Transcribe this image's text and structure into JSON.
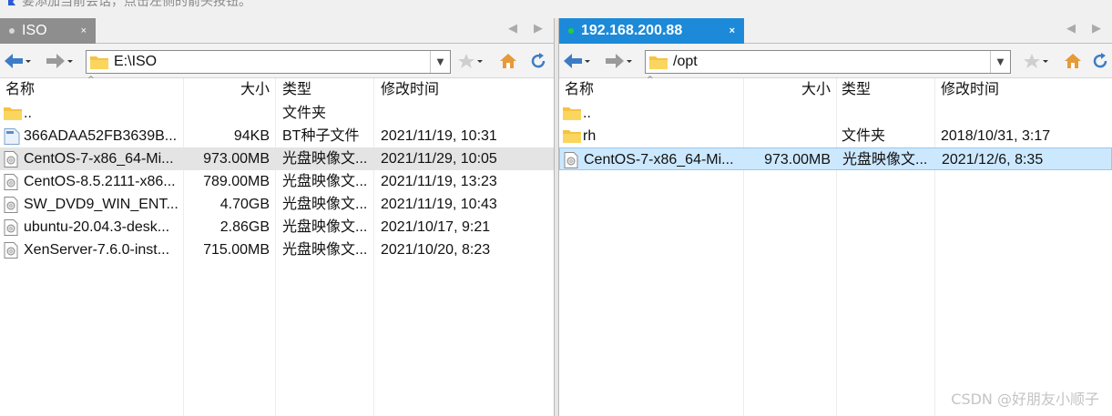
{
  "top_hint": "要添加当前会话，点击左侧的箭头按钮。",
  "left": {
    "tab_title": "ISO",
    "tab_close": "×",
    "path": "E:\\ISO",
    "columns": [
      "名称",
      "大小",
      "类型",
      "修改时间"
    ],
    "rows": [
      {
        "name": "..",
        "size": "",
        "type": "文件夹",
        "modified": "",
        "icon": "folder-icon"
      },
      {
        "name": "366ADAA52FB3639B...",
        "size": "94KB",
        "type": "BT种子文件",
        "modified": "2021/11/19, 10:31",
        "icon": "torrent-file-icon"
      },
      {
        "name": "CentOS-7-x86_64-Mi...",
        "size": "973.00MB",
        "type": "光盘映像文...",
        "modified": "2021/11/29, 10:05",
        "icon": "disc-image-icon",
        "selected": true
      },
      {
        "name": "CentOS-8.5.2111-x86...",
        "size": "789.00MB",
        "type": "光盘映像文...",
        "modified": "2021/11/19, 13:23",
        "icon": "disc-image-icon"
      },
      {
        "name": "SW_DVD9_WIN_ENT...",
        "size": "4.70GB",
        "type": "光盘映像文...",
        "modified": "2021/11/19, 10:43",
        "icon": "disc-image-icon"
      },
      {
        "name": "ubuntu-20.04.3-desk...",
        "size": "2.86GB",
        "type": "光盘映像文...",
        "modified": "2021/10/17, 9:21",
        "icon": "disc-image-icon"
      },
      {
        "name": "XenServer-7.6.0-inst...",
        "size": "715.00MB",
        "type": "光盘映像文...",
        "modified": "2021/10/20, 8:23",
        "icon": "disc-image-icon"
      }
    ]
  },
  "right": {
    "tab_title": "192.168.200.88",
    "tab_close": "×",
    "path": "/opt",
    "columns": [
      "名称",
      "大小",
      "类型",
      "修改时间"
    ],
    "rows": [
      {
        "name": "..",
        "size": "",
        "type": "",
        "modified": "",
        "icon": "folder-icon"
      },
      {
        "name": "rh",
        "size": "",
        "type": "文件夹",
        "modified": "2018/10/31, 3:17",
        "icon": "folder-icon"
      },
      {
        "name": "CentOS-7-x86_64-Mi...",
        "size": "973.00MB",
        "type": "光盘映像文...",
        "modified": "2021/12/6, 8:35",
        "icon": "disc-image-icon",
        "selected": true
      }
    ]
  },
  "watermark": "CSDN @好朋友小顺子"
}
